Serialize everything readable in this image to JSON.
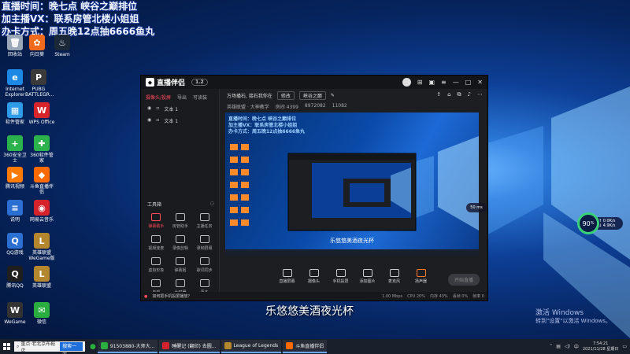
{
  "overlay_lines": [
    "直播时间：晚七点 峡谷之巅排位",
    "加主播VX：联系房管北楼小姐姐",
    "办卡方式：周五晚12点抽6666鱼丸"
  ],
  "desktop_icons": [
    {
      "label": "回收站",
      "color": "#9aa7b8",
      "glyph": "🗑"
    },
    {
      "label": "向日葵",
      "color": "#f26a1b",
      "glyph": "✿"
    },
    {
      "label": "Steam",
      "color": "#1b2838",
      "glyph": "♨"
    },
    {
      "label": "Internet Explorer",
      "color": "#1e88e5",
      "glyph": "e"
    },
    {
      "label": "PUBG BATTLEGR...",
      "color": "#3a3a3a",
      "glyph": "P"
    },
    {
      "label": "软件管家",
      "color": "#2e9be8",
      "glyph": "▦"
    },
    {
      "label": "WPS Office",
      "color": "#d8242b",
      "glyph": "W"
    },
    {
      "label": "360安全卫士",
      "color": "#2bb24c",
      "glyph": "+"
    },
    {
      "label": "360软件管家",
      "color": "#2bb24c",
      "glyph": "✚"
    },
    {
      "label": "腾讯视频",
      "color": "#ff7a00",
      "glyph": "▶"
    },
    {
      "label": "斗鱼直播伴侣",
      "color": "#ff6a00",
      "glyph": "◆"
    },
    {
      "label": "说明",
      "color": "#2a6fd1",
      "glyph": "≡"
    },
    {
      "label": "网易云音乐",
      "color": "#d4232b",
      "glyph": "◉"
    },
    {
      "label": "QQ游戏",
      "color": "#2a6fd1",
      "glyph": "Q"
    },
    {
      "label": "英雄联盟 WeGame版",
      "color": "#b4862d",
      "glyph": "L"
    },
    {
      "label": "腾讯QQ",
      "color": "#1e1e1e",
      "glyph": "Q"
    },
    {
      "label": "英雄联盟",
      "color": "#b4862d",
      "glyph": "L"
    },
    {
      "label": "WeGame",
      "color": "#333",
      "glyph": "W"
    },
    {
      "label": "微信",
      "color": "#2aae3f",
      "glyph": "✉"
    }
  ],
  "window": {
    "title": "直播伴侣",
    "version": "1.2",
    "left_tabs": [
      "摄像头/投屏",
      "导出",
      "可读装"
    ],
    "scenes": [
      "文本 1",
      "文本 1"
    ],
    "tools_title": "工具箱",
    "tools": [
      "弹幕助手",
      "房管助手",
      "主播任务",
      "视频连麦",
      "录像剪辑",
      "录制屏幕",
      "虚拟形象",
      "弹幕姬",
      "歌词同步",
      "美颜",
      "计时器",
      "更多"
    ],
    "info": {
      "room_title": "万场播石, 接石我你在",
      "edit_btn": "修改",
      "category": "峡谷之巅",
      "game": "英雄联盟 · 大神教学",
      "room_id": "房间 4399",
      "fans": "8972082",
      "online": "11082"
    },
    "preview_caption": "乐悠悠美酒夜光杯",
    "controls": [
      "直播屏幕",
      "摄像头",
      "手机投屏",
      "添加图片",
      "麦克风",
      "扬声器"
    ],
    "go_live": "开始直播",
    "status_tip": "如何把手机投屏播放？",
    "status_items": [
      "1.00 Mbps",
      "CPU 20%",
      "内存 43%",
      "丢帧 0%",
      "帧率 0"
    ]
  },
  "caption": "乐悠悠美酒夜光杯",
  "watermark": {
    "line1": "激活 Windows",
    "line2": "转到\"设置\"以激活 Windows。"
  },
  "widget": {
    "percent": "90",
    "unit": "%",
    "up": "↑ 0.0K/s",
    "down": "↓ 4.9K/s"
  },
  "mini_widget": "50 ms",
  "taskbar": {
    "search_placeholder": "重点·老北京布鞋店",
    "search_go": "搜索一下",
    "items": [
      {
        "label": "91503880-大师大...",
        "color": "#2aae3f"
      },
      {
        "label": "睡醒记 (翻印) 去圆...",
        "color": "#d4232b"
      },
      {
        "label": "League of Legends",
        "color": "#b4862d"
      },
      {
        "label": "斗鱼直播伴侣",
        "color": "#ff6a00"
      }
    ],
    "time": "7:54:21",
    "date": "2021/11/28 星期日"
  },
  "colors": {
    "accent": "#ff4a5a",
    "window_bg": "#1d1e22"
  }
}
